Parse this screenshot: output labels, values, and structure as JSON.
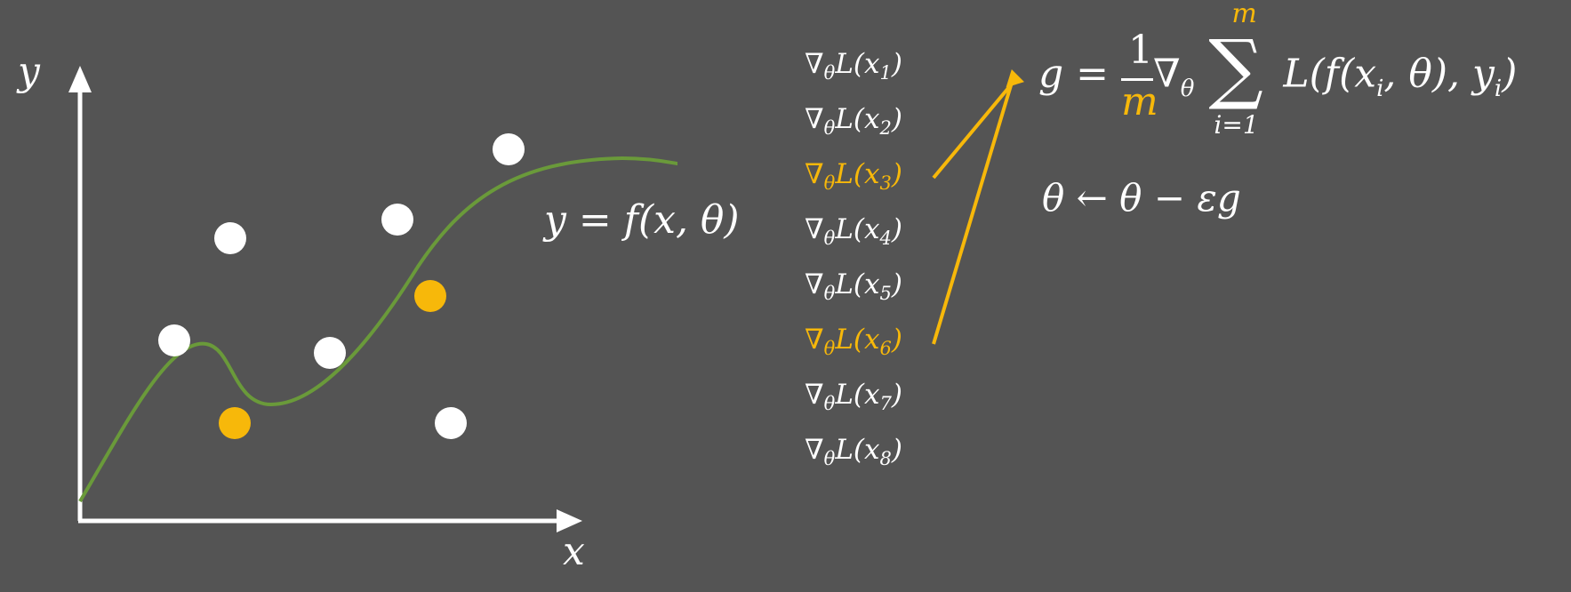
{
  "plot": {
    "x_axis_label": "x",
    "y_axis_label": "y",
    "function_label": "y = f(x, θ)",
    "curve_color": "#6a9a3a",
    "point_color_default": "#ffffff",
    "point_color_highlight": "#f7b80a"
  },
  "gradients": {
    "prefix": "∇",
    "theta_sub": "θ",
    "loss": "L(x",
    "items": [
      {
        "index": "1",
        "highlight": false
      },
      {
        "index": "2",
        "highlight": false
      },
      {
        "index": "3",
        "highlight": true
      },
      {
        "index": "4",
        "highlight": false
      },
      {
        "index": "5",
        "highlight": false
      },
      {
        "index": "6",
        "highlight": true
      },
      {
        "index": "7",
        "highlight": false
      },
      {
        "index": "8",
        "highlight": false
      }
    ]
  },
  "equations": {
    "gradient_lhs": "g =",
    "frac_num": "1",
    "frac_den": "m",
    "nabla": "∇",
    "nabla_sub": "θ",
    "sum_top": "m",
    "sum_symbol": "∑",
    "sum_bottom": "i=1",
    "sum_body": "L(f(x",
    "sum_body_sub1": "i",
    "sum_body_mid": ", θ), y",
    "sum_body_sub2": "i",
    "sum_body_end": ")",
    "update_rule": "θ ← θ − εg"
  },
  "highlight_color": "#f7b80a"
}
